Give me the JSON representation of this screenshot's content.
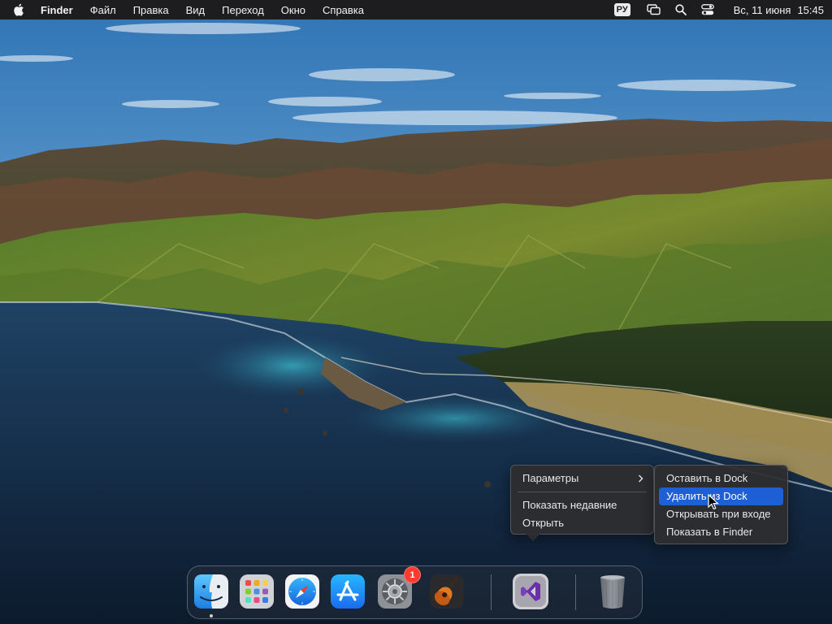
{
  "menubar": {
    "apple_icon": "apple-icon",
    "app_name": "Finder",
    "menus": [
      "Файл",
      "Правка",
      "Вид",
      "Переход",
      "Окно",
      "Справка"
    ],
    "keyboard_layout": "РУ",
    "status_icons": [
      "screen-mirroring-icon",
      "search-icon",
      "control-center-icon"
    ],
    "date": "Вс, 11 июня",
    "time": "15:45"
  },
  "context_menu": {
    "items": [
      {
        "label": "Параметры",
        "has_submenu": true
      },
      {
        "label": "Показать недавние"
      },
      {
        "label": "Открыть"
      }
    ],
    "submenu": [
      {
        "label": "Оставить в Dock",
        "selected": false
      },
      {
        "label": "Удалить из Dock",
        "selected": true
      },
      {
        "label": "Открывать при входе",
        "selected": false
      },
      {
        "label": "Показать в Finder",
        "selected": false
      }
    ]
  },
  "dock": {
    "apps": [
      {
        "name": "finder-icon",
        "running": true
      },
      {
        "name": "launchpad-icon",
        "running": false
      },
      {
        "name": "safari-icon",
        "running": false
      },
      {
        "name": "app-store-icon",
        "running": false
      },
      {
        "name": "system-preferences-icon",
        "running": false,
        "badge": "1"
      },
      {
        "name": "garageband-icon",
        "running": false
      },
      {
        "name": "visual-studio-icon",
        "running": false
      },
      {
        "name": "trash-icon",
        "running": false
      }
    ]
  },
  "colors": {
    "menubar_bg": "#1d1d1f",
    "selection": "#1f5fd6",
    "badge": "#ff3b30"
  }
}
